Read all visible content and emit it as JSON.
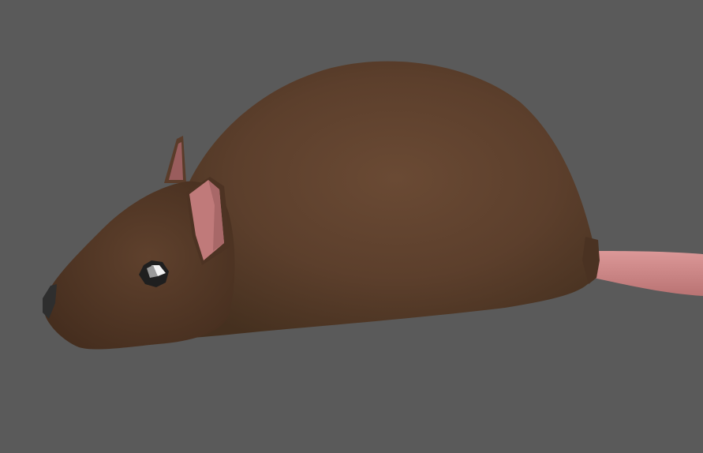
{
  "scene": {
    "subject_icon": "mouse-3d-model",
    "colors": {
      "background": "#5a5a5a",
      "body": "#5c3f2c",
      "body_shadow": "#3f2a1c",
      "body_highlight": "#6a4a34",
      "ear_inner": "#c07a7a",
      "ear_inner_dark": "#9a5d5d",
      "tail": "#d38d8d",
      "tail_shadow": "#b87575",
      "eye": "#1f1f1f",
      "eye_highlight": "#f2f2f2",
      "nose": "#2e2e2e"
    }
  }
}
